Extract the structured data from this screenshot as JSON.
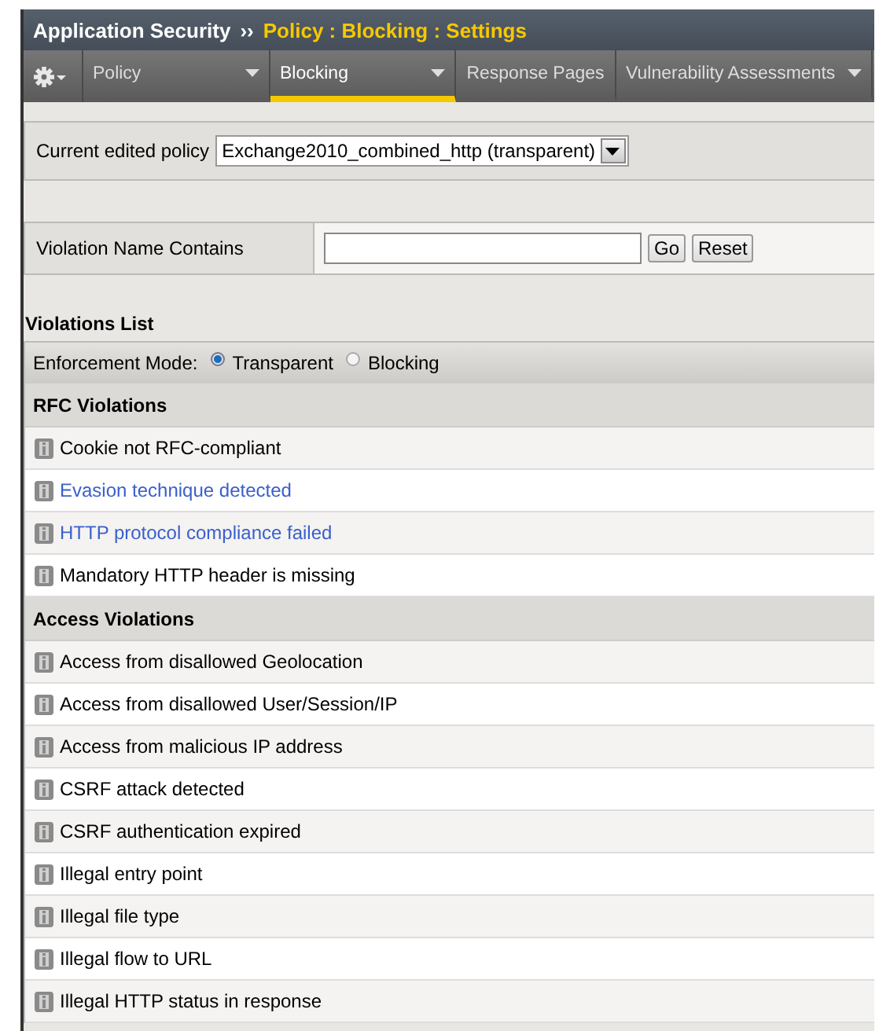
{
  "breadcrumb": {
    "section": "Application Security",
    "separator": "››",
    "page": "Policy : Blocking : Settings"
  },
  "tabs": [
    {
      "label": "Policy",
      "selected": false,
      "dropdown": true
    },
    {
      "label": "Blocking",
      "selected": true,
      "dropdown": true
    },
    {
      "label": "Response Pages",
      "selected": false,
      "dropdown": false
    },
    {
      "label": "Vulnerability Assessments",
      "selected": false,
      "dropdown": true
    }
  ],
  "policy": {
    "label": "Current edited policy",
    "value": "Exchange2010_combined_http (transparent)"
  },
  "filter": {
    "label": "Violation Name Contains",
    "buttons": [
      "Go",
      "Reset"
    ]
  },
  "violations_list": {
    "title": "Violations List",
    "mode_label": "Enforcement Mode:",
    "modes": [
      {
        "label": "Transparent",
        "selected": true
      },
      {
        "label": "Blocking",
        "selected": false
      }
    ],
    "groups": [
      {
        "title": "RFC Violations",
        "items": [
          {
            "label": "Cookie not RFC-compliant",
            "kind": "text"
          },
          {
            "label": "Evasion technique detected",
            "kind": "link"
          },
          {
            "label": "HTTP protocol compliance failed",
            "kind": "link"
          },
          {
            "label": "Mandatory HTTP header is missing",
            "kind": "text"
          }
        ]
      },
      {
        "title": "Access Violations",
        "items": [
          {
            "label": "Access from disallowed Geolocation",
            "kind": "text"
          },
          {
            "label": "Access from disallowed User/Session/IP",
            "kind": "text"
          },
          {
            "label": "Access from malicious IP address",
            "kind": "text"
          },
          {
            "label": "CSRF attack detected",
            "kind": "text"
          },
          {
            "label": "CSRF authentication expired",
            "kind": "text"
          },
          {
            "label": "Illegal entry point",
            "kind": "text"
          },
          {
            "label": "Illegal file type",
            "kind": "text"
          },
          {
            "label": "Illegal flow to URL",
            "kind": "text"
          },
          {
            "label": "Illegal HTTP status in response",
            "kind": "text"
          }
        ]
      }
    ]
  }
}
